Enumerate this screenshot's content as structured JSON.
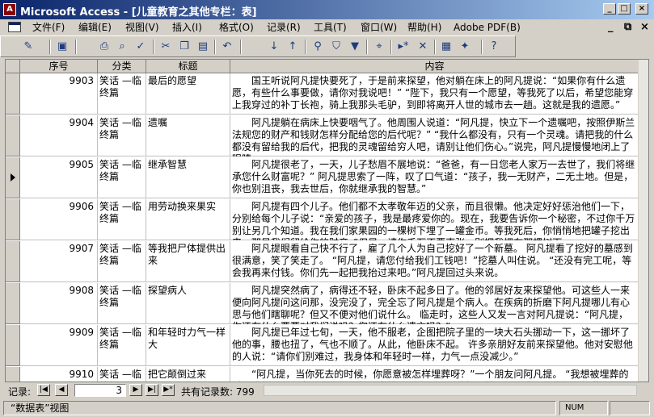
{
  "window": {
    "app_icon": "access-key-icon",
    "title": "Microsoft Access - [儿童教育之其他专栏：表]"
  },
  "menu": {
    "items": [
      "文件(F)",
      "编辑(E)",
      "视图(V)",
      "插入(I)",
      "格式(O)",
      "记录(R)",
      "工具(T)",
      "窗口(W)",
      "帮助(H)",
      "Adobe PDF(B)"
    ]
  },
  "toolbar": {
    "icons": [
      "view-icon",
      "save-icon",
      "print-icon",
      "print-preview-icon",
      "spelling-icon",
      "cut-icon",
      "copy-icon",
      "paste-icon",
      "undo-icon",
      "sort-ascending-icon",
      "sort-descending-icon",
      "filter-by-selection-icon",
      "filter-by-form-icon",
      "apply-filter-icon",
      "find-icon",
      "new-record-icon",
      "delete-record-icon",
      "database-window-icon",
      "new-object-icon",
      "help-icon"
    ]
  },
  "grid": {
    "columns": [
      "序号",
      "分类",
      "标题",
      "内容"
    ],
    "current_row": 2,
    "rows": [
      {
        "id": "9903",
        "cat": "笑话 —临终篇",
        "title": "最后的愿望",
        "content": "国王听说阿凡提快要死了，于是前来探望，他对躺在床上的阿凡提说：“如果你有什么遗愿，有些什么事要做，请你对我说吧！” “陛下，我只有一个愿望，等我死了以后，希望您能穿上我穿过的补丁长袍，骑上我那头毛驴，到即将离开人世的城市去一趟。这就是我的遗愿。”"
      },
      {
        "id": "9904",
        "cat": "笑话 —临终篇",
        "title": "遗嘱",
        "content": "阿凡提躺在病床上快要咽气了。他周围人说道：“阿凡提，快立下一个遗嘱吧，按照伊斯兰法规您的财产和钱财怎样分配给您的后代呢？” “我什么都没有，只有一个灵魂。请把我的什么都没有留给我的后代，把我的灵魂留给穷人吧，请别让他们伤心。”说完，阿凡提慢慢地闭上了眼睛。"
      },
      {
        "id": "9905",
        "cat": "笑话 —临终篇",
        "title": "继承智慧",
        "content": "阿凡提很老了，一天，儿子愁眉不展地说：“爸爸，有一日您老人家万一去世了，我们将继承您什么财富呢？” 阿凡提思索了一阵，叹了口气道：“孩子，我一无财产，二无土地。但是，你也别沮丧，我去世后，你就继承我的智慧。”"
      },
      {
        "id": "9906",
        "cat": "笑话 —临终篇",
        "title": "用劳动换来果实",
        "content": "阿凡提有四个儿子。他们都不太孝敬年迈的父亲，而且很懒。他决定好好惩治他们一下，分别给每个儿子说：“亲爱的孩子，我是最疼爱你的。现在，我要告诉你一个秘密，不过你千万别让另几个知道。我在我们家果园的一棵树下埋了一罐金币。等我死后，你悄悄地把罐子挖出来，那是我们留给你的财产。”但是，请你千万不要声张，别把我埋在那棵树下。"
      },
      {
        "id": "9907",
        "cat": "笑话 —临终篇",
        "title": "等我把尸体提供出来",
        "content": "阿凡提眼看自己快不行了，雇了几个人为自己挖好了一个新墓。 阿凡提看了挖好的墓感到很满意，笑了笑走了。 “阿凡提，请您付给我们工钱吧！”挖墓人叫住说。 “还没有完工呢，等会我再来付钱。你们先一起把我抬过来吧。”阿凡提回过头来说。"
      },
      {
        "id": "9908",
        "cat": "笑话 —临终篇",
        "title": "探望病人",
        "content": "阿凡提突然病了，病得还不轻，卧床不起多日了。他的邻居好友来探望他。可这些人一来便向阿凡提问这问那，没完没了，完全忘了阿凡提是个病人。在疾病的折磨下阿凡提哪儿有心思与他们瞎聊呢？但又不便对他们说什么。 临走时，这些人又发一言对阿凡提说：“阿凡提，你还有什么要要对我们说吗？您还有什么遗言吗？”"
      },
      {
        "id": "9909",
        "cat": "笑话 —临终篇",
        "title": "和年轻时力气一样大",
        "content": "阿凡提已年过七旬，一天，他不服老，企图把院子里的一块大石头挪动一下，这一挪坏了他的事，腰也扭了，气也不顺了。从此，他卧床不起。 许多亲朋好友前来探望他。他对安慰他的人说：“请你们别难过，我身体和年轻时一样，力气一点没减少。”"
      },
      {
        "id": "9910",
        "cat": "笑话 —临终篇",
        "title": "把它颠倒过来",
        "content": "“阿凡提，当你死去的时候，你愿意被怎样埋葬呀？”一个朋友问阿凡提。 “我想被埋葬的时候头朝下，因为，我们死后都要去地狱，我可不愿被颠倒着，所以我要求头朝下埋葬。”"
      }
    ]
  },
  "nav": {
    "label": "记录:",
    "current": "3",
    "total_text": "共有记录数: 799",
    "buttons": [
      "first-record-icon",
      "previous-record-icon",
      "next-record-icon",
      "last-record-icon",
      "new-record-icon"
    ]
  },
  "status": {
    "view": "“数据表”视图",
    "num": "NUM"
  }
}
